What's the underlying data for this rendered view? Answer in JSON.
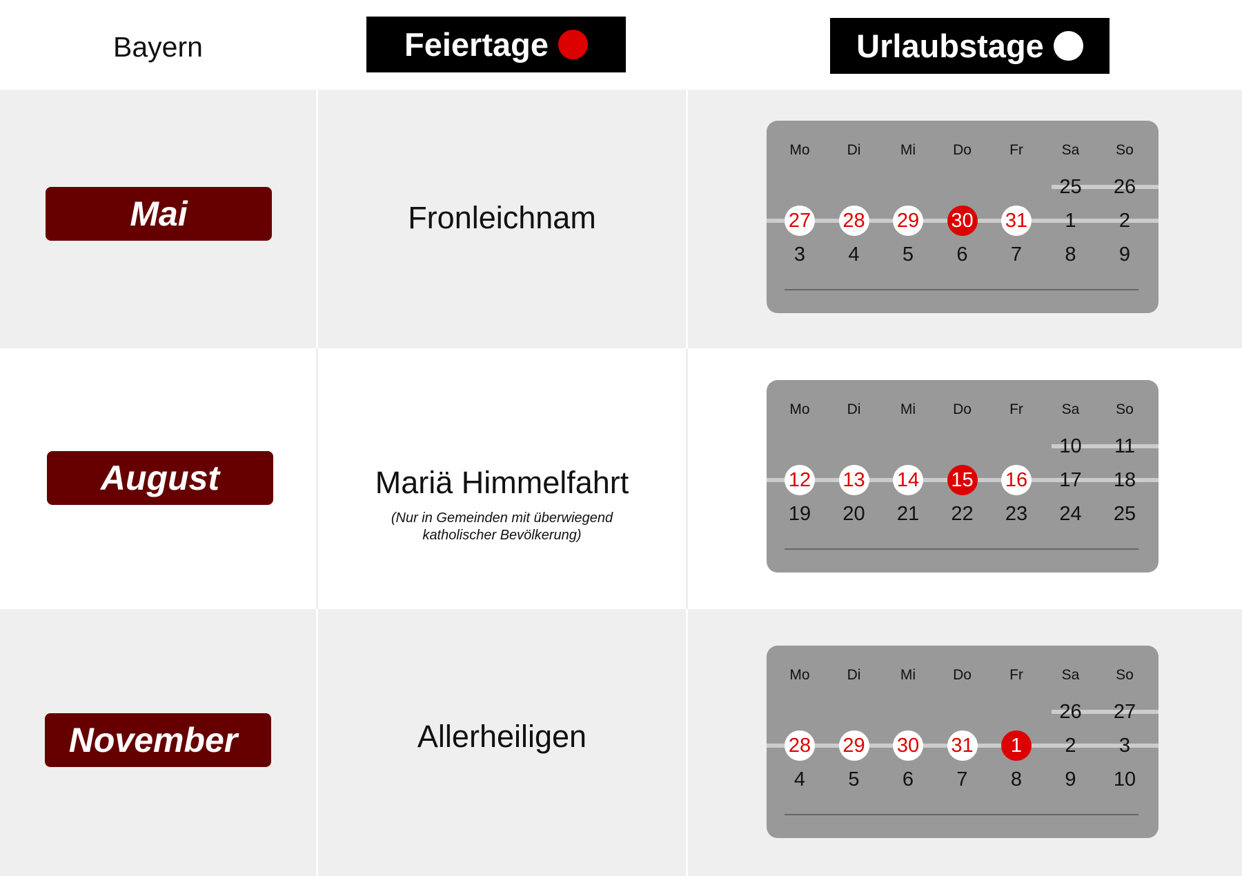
{
  "header": {
    "state": "Bayern",
    "legend_holidays": {
      "label": "Feiertage",
      "dot_color": "#dd0000"
    },
    "legend_vacation": {
      "label": "Urlaubstage",
      "dot_color": "#ffffff"
    }
  },
  "colors": {
    "month_badge": "#660000",
    "holiday_red": "#dd0000",
    "calendar_bg": "#999999",
    "vacation_bar": "#cccccc"
  },
  "weekdays": [
    "Mo",
    "Di",
    "Mi",
    "Do",
    "Fr",
    "Sa",
    "So"
  ],
  "rows": [
    {
      "month": "Mai",
      "holiday": "Fronleichnam",
      "note": "",
      "calendar": {
        "weeks": [
          [
            null,
            null,
            null,
            null,
            null,
            25,
            26
          ],
          [
            27,
            28,
            29,
            30,
            31,
            1,
            2
          ],
          [
            3,
            4,
            5,
            6,
            7,
            8,
            9
          ]
        ],
        "vacation_days": [
          27,
          28,
          29,
          31
        ],
        "holiday_days": [
          30
        ],
        "bridge_start": {
          "week": 0,
          "col": 5
        }
      }
    },
    {
      "month": "August",
      "holiday": "Mariä Himmelfahrt",
      "note_line1": "(Nur in Gemeinden mit überwiegend",
      "note_line2": "katholischer Bevölkerung)",
      "calendar": {
        "weeks": [
          [
            null,
            null,
            null,
            null,
            null,
            10,
            11
          ],
          [
            12,
            13,
            14,
            15,
            16,
            17,
            18
          ],
          [
            19,
            20,
            21,
            22,
            23,
            24,
            25
          ]
        ],
        "vacation_days": [
          12,
          13,
          14,
          16
        ],
        "holiday_days": [
          15
        ],
        "bridge_start": {
          "week": 0,
          "col": 5
        }
      }
    },
    {
      "month": "November",
      "holiday": "Allerheiligen",
      "note": "",
      "calendar": {
        "weeks": [
          [
            null,
            null,
            null,
            null,
            null,
            26,
            27
          ],
          [
            28,
            29,
            30,
            31,
            1,
            2,
            3
          ],
          [
            4,
            5,
            6,
            7,
            8,
            9,
            10
          ]
        ],
        "vacation_days": [
          28,
          29,
          30,
          31
        ],
        "holiday_days": [
          1
        ],
        "bridge_start": {
          "week": 0,
          "col": 5
        }
      }
    }
  ]
}
